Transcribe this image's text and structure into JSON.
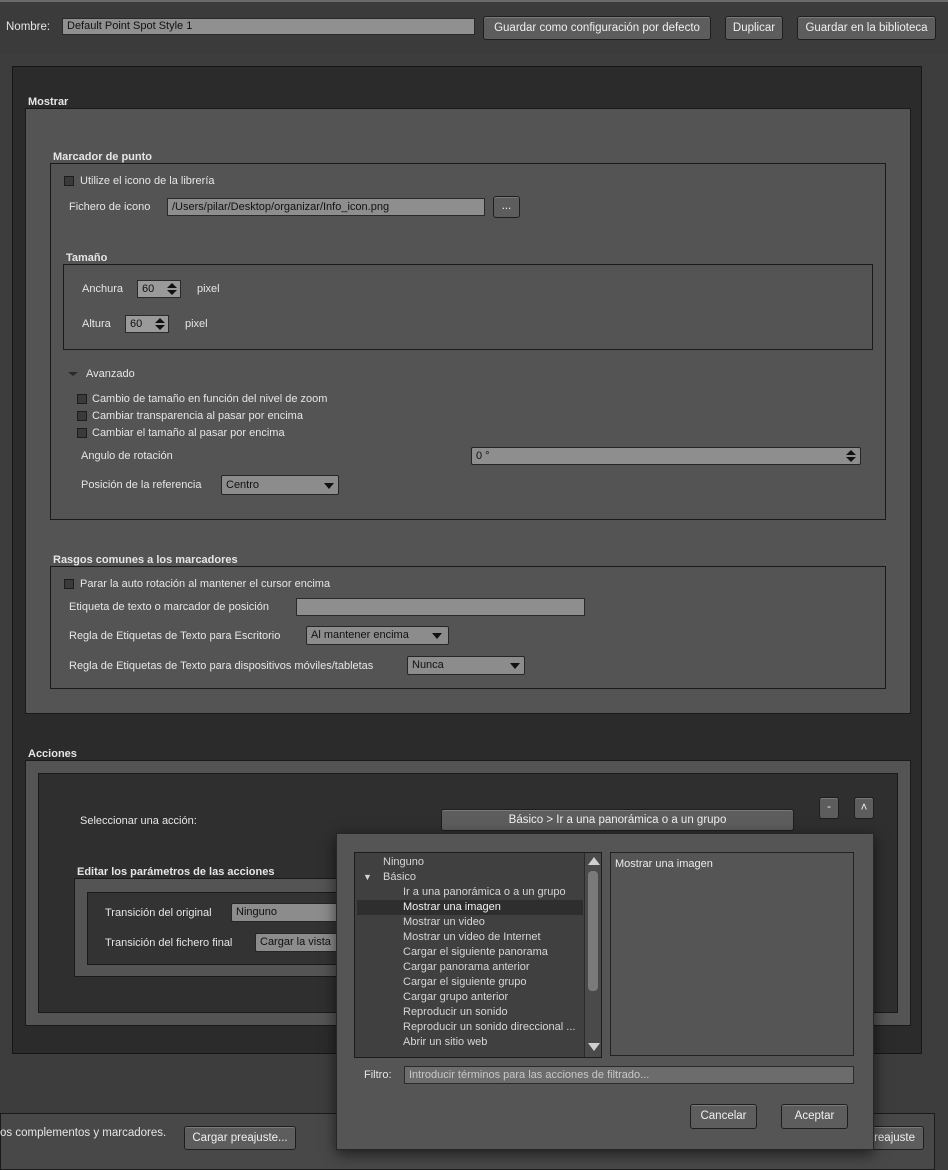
{
  "header": {
    "name_label": "Nombre:",
    "name_value": "Default Point Spot Style 1",
    "save_default": "Guardar como configuración por defecto",
    "duplicate": "Duplicar",
    "save_library": "Guardar en la biblioteca"
  },
  "mostrar": {
    "title": "Mostrar",
    "marker": {
      "title": "Marcador de punto",
      "use_library_icon": "Utilize el icono de la librería",
      "icon_file_label": "Fichero de icono",
      "icon_file_value": "/Users/pilar/Desktop/organizar/Info_icon.png",
      "browse": "...",
      "size_title": "Tamaño",
      "width_label": "Anchura",
      "width_value": "60",
      "height_label": "Altura",
      "height_value": "60",
      "unit": "pixel",
      "advanced": "Avanzado",
      "opt_zoom": "Cambio de tamaño en función del nivel de zoom",
      "opt_transparency": "Cambiar transparencia al pasar por encima",
      "opt_resize": "Cambiar el tamaño al pasar por encima",
      "rotation_label": "Angulo de rotación",
      "rotation_value": "0 °",
      "anchor_label": "Posición de la referencia",
      "anchor_value": "Centro"
    },
    "common": {
      "title": "Rasgos comunes a los marcadores",
      "stop_autorotate": "Parar la auto rotación al mantener el cursor encima",
      "text_label_label": "Etiqueta de texto o marcador de posición",
      "text_label_value": "",
      "desktop_rule_label": "Regla de Etiquetas de Texto para Escritorio",
      "desktop_rule_value": "Al mantener encima",
      "mobile_rule_label": "Regla de Etiquetas de Texto para dispositivos móviles/tabletas",
      "mobile_rule_value": "Nunca"
    }
  },
  "acciones": {
    "title": "Acciones",
    "select_action_label": "Seleccionar una acción:",
    "select_action_value": "Básico > Ir a una panorámica o a un grupo",
    "minus": "-",
    "up": "˄",
    "edit_title": "Editar los parámetros de las acciones",
    "transition_original_label": "Transición del original",
    "transition_original_value": "Ninguno",
    "transition_final_label": "Transición del fichero final",
    "transition_final_value": "Cargar la vista"
  },
  "bottom": {
    "text": "os complementos y marcadores.",
    "load_preset": "Cargar preajuste...",
    "preset_right": "reajuste"
  },
  "popup": {
    "list": [
      {
        "label": "Ninguno",
        "indent": 0
      },
      {
        "label": "Básico",
        "indent": 0,
        "expander": "▼"
      },
      {
        "label": "Ir a una panorámica o a un grupo",
        "indent": 1
      },
      {
        "label": "Mostrar una imagen",
        "indent": 1,
        "selected": true
      },
      {
        "label": "Mostrar un video",
        "indent": 1
      },
      {
        "label": "Mostrar un video de Internet",
        "indent": 1
      },
      {
        "label": "Cargar el siguiente panorama",
        "indent": 1
      },
      {
        "label": "Cargar panorama anterior",
        "indent": 1
      },
      {
        "label": "Cargar el siguiente grupo",
        "indent": 1
      },
      {
        "label": "Cargar grupo anterior",
        "indent": 1
      },
      {
        "label": "Reproducir un sonido",
        "indent": 1
      },
      {
        "label": "Reproducir un sonido direccional ...",
        "indent": 1
      },
      {
        "label": "Abrir un sitio web",
        "indent": 1
      }
    ],
    "description": "Mostrar una imagen",
    "filter_label": "Filtro:",
    "filter_placeholder": "Introducir términos para las acciones de filtrado...",
    "cancel": "Cancelar",
    "accept": "Aceptar"
  }
}
